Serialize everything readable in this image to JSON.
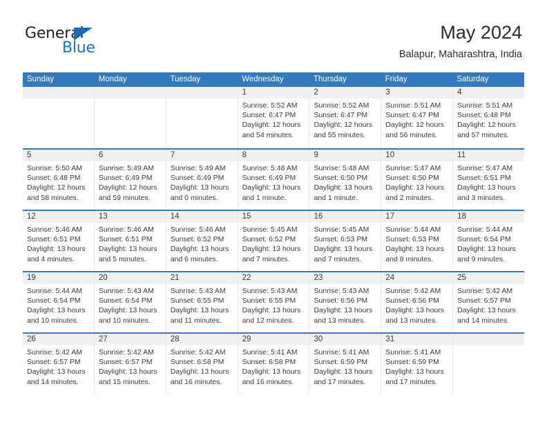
{
  "brand": {
    "name_top": "General",
    "name_bottom": "Blue",
    "triangle_color": "#1d6cb3",
    "text_color": "#231f20",
    "blue_color": "#1b72c0"
  },
  "header": {
    "title": "May 2024",
    "subtitle": "Balapur, Maharashtra, India"
  },
  "theme": {
    "header_bg": "#3279bd",
    "header_text": "#ffffff",
    "day_strip_bg": "#f0f0f0",
    "row_divider": "#3279bd",
    "cell_divider": "#e8e8e8",
    "body_text": "#3a3a3a"
  },
  "weekdays": [
    "Sunday",
    "Monday",
    "Tuesday",
    "Wednesday",
    "Thursday",
    "Friday",
    "Saturday"
  ],
  "weeks": [
    [
      {
        "day": "",
        "sunrise": "",
        "sunset": "",
        "daylight_line1": "",
        "daylight_line2": ""
      },
      {
        "day": "",
        "sunrise": "",
        "sunset": "",
        "daylight_line1": "",
        "daylight_line2": ""
      },
      {
        "day": "",
        "sunrise": "",
        "sunset": "",
        "daylight_line1": "",
        "daylight_line2": ""
      },
      {
        "day": "1",
        "sunrise": "Sunrise: 5:52 AM",
        "sunset": "Sunset: 6:47 PM",
        "daylight_line1": "Daylight: 12 hours",
        "daylight_line2": "and 54 minutes."
      },
      {
        "day": "2",
        "sunrise": "Sunrise: 5:52 AM",
        "sunset": "Sunset: 6:47 PM",
        "daylight_line1": "Daylight: 12 hours",
        "daylight_line2": "and 55 minutes."
      },
      {
        "day": "3",
        "sunrise": "Sunrise: 5:51 AM",
        "sunset": "Sunset: 6:47 PM",
        "daylight_line1": "Daylight: 12 hours",
        "daylight_line2": "and 56 minutes."
      },
      {
        "day": "4",
        "sunrise": "Sunrise: 5:51 AM",
        "sunset": "Sunset: 6:48 PM",
        "daylight_line1": "Daylight: 12 hours",
        "daylight_line2": "and 57 minutes."
      }
    ],
    [
      {
        "day": "5",
        "sunrise": "Sunrise: 5:50 AM",
        "sunset": "Sunset: 6:48 PM",
        "daylight_line1": "Daylight: 12 hours",
        "daylight_line2": "and 58 minutes."
      },
      {
        "day": "6",
        "sunrise": "Sunrise: 5:49 AM",
        "sunset": "Sunset: 6:49 PM",
        "daylight_line1": "Daylight: 12 hours",
        "daylight_line2": "and 59 minutes."
      },
      {
        "day": "7",
        "sunrise": "Sunrise: 5:49 AM",
        "sunset": "Sunset: 6:49 PM",
        "daylight_line1": "Daylight: 13 hours",
        "daylight_line2": "and 0 minutes."
      },
      {
        "day": "8",
        "sunrise": "Sunrise: 5:48 AM",
        "sunset": "Sunset: 6:49 PM",
        "daylight_line1": "Daylight: 13 hours",
        "daylight_line2": "and 1 minute."
      },
      {
        "day": "9",
        "sunrise": "Sunrise: 5:48 AM",
        "sunset": "Sunset: 6:50 PM",
        "daylight_line1": "Daylight: 13 hours",
        "daylight_line2": "and 1 minute."
      },
      {
        "day": "10",
        "sunrise": "Sunrise: 5:47 AM",
        "sunset": "Sunset: 6:50 PM",
        "daylight_line1": "Daylight: 13 hours",
        "daylight_line2": "and 2 minutes."
      },
      {
        "day": "11",
        "sunrise": "Sunrise: 5:47 AM",
        "sunset": "Sunset: 6:51 PM",
        "daylight_line1": "Daylight: 13 hours",
        "daylight_line2": "and 3 minutes."
      }
    ],
    [
      {
        "day": "12",
        "sunrise": "Sunrise: 5:46 AM",
        "sunset": "Sunset: 6:51 PM",
        "daylight_line1": "Daylight: 13 hours",
        "daylight_line2": "and 4 minutes."
      },
      {
        "day": "13",
        "sunrise": "Sunrise: 5:46 AM",
        "sunset": "Sunset: 6:51 PM",
        "daylight_line1": "Daylight: 13 hours",
        "daylight_line2": "and 5 minutes."
      },
      {
        "day": "14",
        "sunrise": "Sunrise: 5:46 AM",
        "sunset": "Sunset: 6:52 PM",
        "daylight_line1": "Daylight: 13 hours",
        "daylight_line2": "and 6 minutes."
      },
      {
        "day": "15",
        "sunrise": "Sunrise: 5:45 AM",
        "sunset": "Sunset: 6:52 PM",
        "daylight_line1": "Daylight: 13 hours",
        "daylight_line2": "and 7 minutes."
      },
      {
        "day": "16",
        "sunrise": "Sunrise: 5:45 AM",
        "sunset": "Sunset: 6:53 PM",
        "daylight_line1": "Daylight: 13 hours",
        "daylight_line2": "and 7 minutes."
      },
      {
        "day": "17",
        "sunrise": "Sunrise: 5:44 AM",
        "sunset": "Sunset: 6:53 PM",
        "daylight_line1": "Daylight: 13 hours",
        "daylight_line2": "and 8 minutes."
      },
      {
        "day": "18",
        "sunrise": "Sunrise: 5:44 AM",
        "sunset": "Sunset: 6:54 PM",
        "daylight_line1": "Daylight: 13 hours",
        "daylight_line2": "and 9 minutes."
      }
    ],
    [
      {
        "day": "19",
        "sunrise": "Sunrise: 5:44 AM",
        "sunset": "Sunset: 6:54 PM",
        "daylight_line1": "Daylight: 13 hours",
        "daylight_line2": "and 10 minutes."
      },
      {
        "day": "20",
        "sunrise": "Sunrise: 5:43 AM",
        "sunset": "Sunset: 6:54 PM",
        "daylight_line1": "Daylight: 13 hours",
        "daylight_line2": "and 10 minutes."
      },
      {
        "day": "21",
        "sunrise": "Sunrise: 5:43 AM",
        "sunset": "Sunset: 6:55 PM",
        "daylight_line1": "Daylight: 13 hours",
        "daylight_line2": "and 11 minutes."
      },
      {
        "day": "22",
        "sunrise": "Sunrise: 5:43 AM",
        "sunset": "Sunset: 6:55 PM",
        "daylight_line1": "Daylight: 13 hours",
        "daylight_line2": "and 12 minutes."
      },
      {
        "day": "23",
        "sunrise": "Sunrise: 5:43 AM",
        "sunset": "Sunset: 6:56 PM",
        "daylight_line1": "Daylight: 13 hours",
        "daylight_line2": "and 13 minutes."
      },
      {
        "day": "24",
        "sunrise": "Sunrise: 5:42 AM",
        "sunset": "Sunset: 6:56 PM",
        "daylight_line1": "Daylight: 13 hours",
        "daylight_line2": "and 13 minutes."
      },
      {
        "day": "25",
        "sunrise": "Sunrise: 5:42 AM",
        "sunset": "Sunset: 6:57 PM",
        "daylight_line1": "Daylight: 13 hours",
        "daylight_line2": "and 14 minutes."
      }
    ],
    [
      {
        "day": "26",
        "sunrise": "Sunrise: 5:42 AM",
        "sunset": "Sunset: 6:57 PM",
        "daylight_line1": "Daylight: 13 hours",
        "daylight_line2": "and 14 minutes."
      },
      {
        "day": "27",
        "sunrise": "Sunrise: 5:42 AM",
        "sunset": "Sunset: 6:57 PM",
        "daylight_line1": "Daylight: 13 hours",
        "daylight_line2": "and 15 minutes."
      },
      {
        "day": "28",
        "sunrise": "Sunrise: 5:42 AM",
        "sunset": "Sunset: 6:58 PM",
        "daylight_line1": "Daylight: 13 hours",
        "daylight_line2": "and 16 minutes."
      },
      {
        "day": "29",
        "sunrise": "Sunrise: 5:41 AM",
        "sunset": "Sunset: 6:58 PM",
        "daylight_line1": "Daylight: 13 hours",
        "daylight_line2": "and 16 minutes."
      },
      {
        "day": "30",
        "sunrise": "Sunrise: 5:41 AM",
        "sunset": "Sunset: 6:59 PM",
        "daylight_line1": "Daylight: 13 hours",
        "daylight_line2": "and 17 minutes."
      },
      {
        "day": "31",
        "sunrise": "Sunrise: 5:41 AM",
        "sunset": "Sunset: 6:59 PM",
        "daylight_line1": "Daylight: 13 hours",
        "daylight_line2": "and 17 minutes."
      },
      {
        "day": "",
        "sunrise": "",
        "sunset": "",
        "daylight_line1": "",
        "daylight_line2": ""
      }
    ]
  ]
}
